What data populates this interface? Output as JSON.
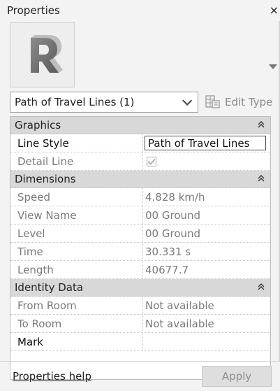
{
  "window": {
    "title": "Properties",
    "close_glyph": "×"
  },
  "type_selector": {
    "thumbnail_icon": "revit-logo-icon",
    "thumbnail_letter": "R",
    "selected": "Path of Travel Lines (1)",
    "edit_type_label": "Edit Type"
  },
  "groups": {
    "graphics": {
      "label": "Graphics",
      "collapse_glyph": "»"
    },
    "dimensions": {
      "label": "Dimensions",
      "collapse_glyph": "»"
    },
    "identity": {
      "label": "Identity Data",
      "collapse_glyph": "»"
    }
  },
  "graphics": {
    "line_style_label": "Line Style",
    "line_style_value": "Path of Travel Lines",
    "detail_line_label": "Detail Line",
    "detail_line_checked": true
  },
  "dimensions": {
    "speed_label": "Speed",
    "speed_value": "4.828 km/h",
    "view_name_label": "View Name",
    "view_name_value": "00 Ground",
    "level_label": "Level",
    "level_value": "00 Ground",
    "time_label": "Time",
    "time_value": "30.331 s",
    "length_label": "Length",
    "length_value": "40677.7"
  },
  "identity": {
    "from_room_label": "From Room",
    "from_room_value": "Not available",
    "to_room_label": "To Room",
    "to_room_value": "Not available",
    "mark_label": "Mark",
    "mark_value": ""
  },
  "footer": {
    "help_label": "Properties help",
    "apply_label": "Apply"
  }
}
